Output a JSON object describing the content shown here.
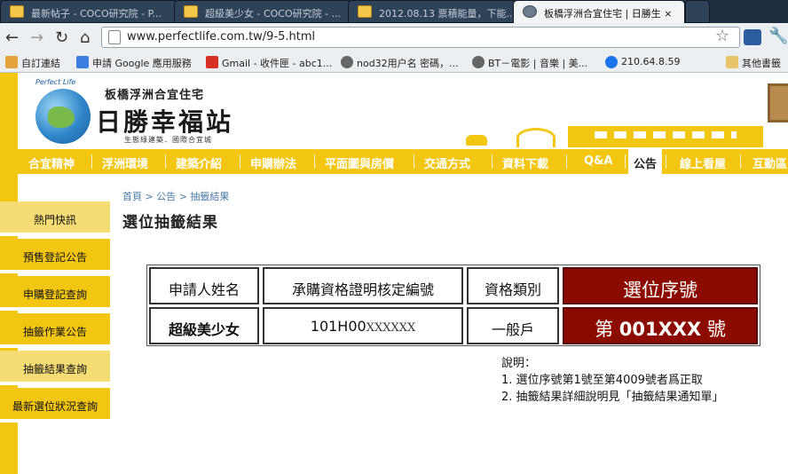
{
  "browser": {
    "tabs": [
      {
        "label": "最新帖子 - COCO研究院 - P..."
      },
      {
        "label": "超級美少女 - COCO研究院 - ..."
      },
      {
        "label": "2012.08.13 票積能量，下能..."
      },
      {
        "label": "板橋浮洲合宜住宅 | 日勝生 ×"
      }
    ],
    "url": "www.perfectlife.com.tw/9-5.html",
    "bookmarks": [
      {
        "label": "自訂連結"
      },
      {
        "label": "申請 Google 應用服務"
      },
      {
        "label": "Gmail - 收件匣 - abc1..."
      },
      {
        "label": "nod32用户名 密碼，..."
      },
      {
        "label": "BT－電影 | 音樂 | 美..."
      },
      {
        "label": "210.64.8.59"
      },
      {
        "label": "其他書籤"
      }
    ]
  },
  "site": {
    "brand_top": "板橋浮洲合宜住宅",
    "brand_name": "日勝幸福站",
    "brand_sub": "生態綠建築．國際合宜城",
    "brand_english": "Perfect  Life",
    "nav": [
      "合宜精神",
      "浮洲環境",
      "建築介紹",
      "申購辦法",
      "平面圖與房價",
      "交通方式",
      "資料下載",
      "Q&A",
      "公告",
      "線上看屋",
      "互動區"
    ],
    "nav_active": "公告",
    "sidebar": [
      "熱門快訊",
      "預售登記公告",
      "申購登記查詢",
      "抽籤作業公告",
      "抽籤結果查詢",
      "最新選位狀況查詢"
    ],
    "breadcrumb": "首頁 > 公告 > 抽籤結果",
    "page_title": "選位抽籤結果"
  },
  "result_table": {
    "headers": [
      "申請人姓名",
      "承購資格證明核定編號",
      "資格類別",
      "選位序號"
    ],
    "row": {
      "name": "超級美少女",
      "cert_no": "101H00",
      "cert_mask": "XXXXXX",
      "category": "一般戶",
      "seq_prefix": "第",
      "seq_value": "001XXX",
      "seq_suffix": "號"
    }
  },
  "notes": {
    "title": "說明：",
    "items": [
      "1. 選位序號第1號至第4009號者爲正取",
      "2. 抽籤結果詳細說明見「抽籤結果通知單」"
    ]
  }
}
